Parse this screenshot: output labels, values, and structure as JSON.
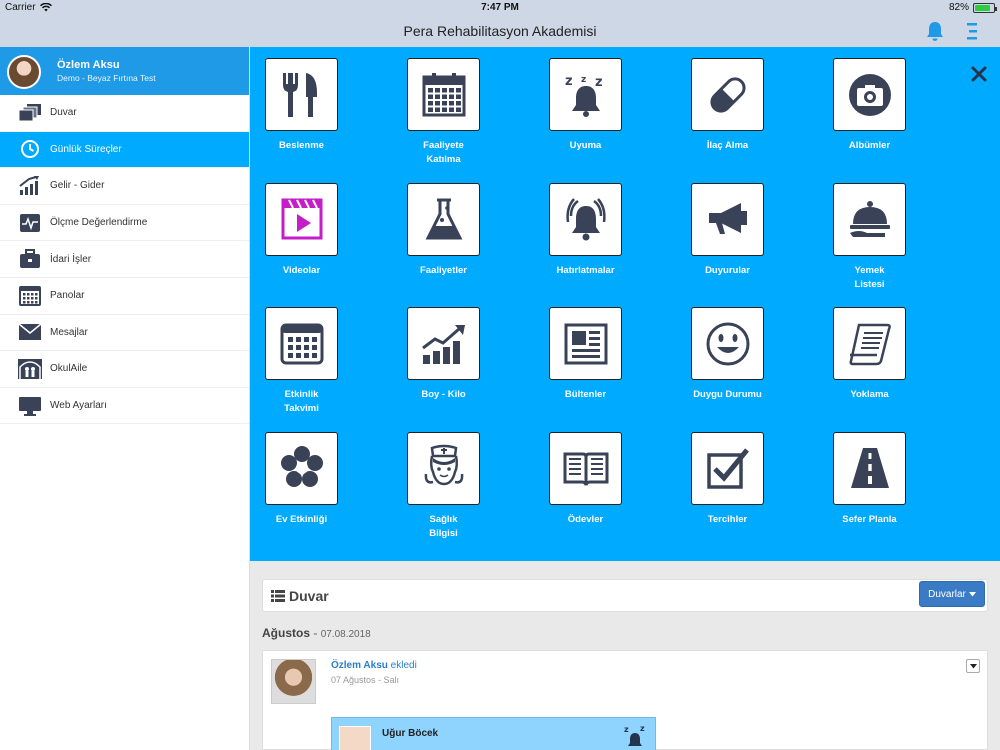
{
  "status_bar": {
    "carrier": "Carrier",
    "time": "7:47 PM",
    "battery": "82%",
    "battery_level": 0.82
  },
  "nav": {
    "title": "Pera Rehabilitasyon Akademisi"
  },
  "profile": {
    "name": "Özlem Aksu",
    "subtitle": "Demo - Beyaz Fırtına Test"
  },
  "sidebar": {
    "items": [
      {
        "label": "Duvar",
        "icon": "wall-icon"
      },
      {
        "label": "Günlük Süreçler",
        "icon": "clock-icon",
        "active": true
      },
      {
        "label": "Gelir - Gider",
        "icon": "growth-chart-icon"
      },
      {
        "label": "Ölçme Değerlendirme",
        "icon": "pulse-monitor-icon"
      },
      {
        "label": "İdari İşler",
        "icon": "briefcase-icon"
      },
      {
        "label": "Panolar",
        "icon": "calendar-board-icon"
      },
      {
        "label": "Mesajlar",
        "icon": "envelope-icon"
      },
      {
        "label": "OkulAile",
        "icon": "family-icon"
      },
      {
        "label": "Web Ayarları",
        "icon": "monitor-icon"
      }
    ]
  },
  "grid": {
    "tiles": [
      {
        "label": "Beslenme",
        "icon": "fork-knife-icon"
      },
      {
        "label": "Faaliyete Katılma",
        "icon": "calendar-grid-icon"
      },
      {
        "label": "Uyuma",
        "icon": "sleep-bell-icon"
      },
      {
        "label": "İlaç Alma",
        "icon": "pill-icon"
      },
      {
        "label": "Albümler",
        "icon": "camera-icon"
      },
      {
        "label": "Videolar",
        "icon": "video-clapper-icon"
      },
      {
        "label": "Faaliyetler",
        "icon": "flask-icon"
      },
      {
        "label": "Hatırlatmalar",
        "icon": "alarm-bell-icon"
      },
      {
        "label": "Duyurular",
        "icon": "megaphone-icon"
      },
      {
        "label": "Yemek Listesi",
        "icon": "food-cloche-icon"
      },
      {
        "label": "Etkinlik Takvimi",
        "icon": "event-calendar-icon"
      },
      {
        "label": "Boy - Kilo",
        "icon": "growth-bars-icon"
      },
      {
        "label": "Bültenler",
        "icon": "newsletter-icon"
      },
      {
        "label": "Duygu Durumu",
        "icon": "smiley-icon"
      },
      {
        "label": "Yoklama",
        "icon": "scroll-list-icon"
      },
      {
        "label": "Ev Etkinliği",
        "icon": "flower-icon"
      },
      {
        "label": "Sağlık Bilgisi",
        "icon": "nurse-icon"
      },
      {
        "label": "Ödevler",
        "icon": "open-book-icon"
      },
      {
        "label": "Tercihler",
        "icon": "checkbox-icon"
      },
      {
        "label": "Sefer Planla",
        "icon": "road-icon"
      }
    ]
  },
  "wall": {
    "title": "Duvar",
    "button": "Duvarlar",
    "month": "Ağustos",
    "date": "07.08.2018",
    "post": {
      "author": "Özlem Aksu",
      "action": "ekledi",
      "date": "07 Ağustos - Salı",
      "card_name": "Uğur Böcek"
    }
  },
  "colors": {
    "accent": "#00aaff",
    "profile_bg": "#1e9ae6",
    "navbar_bg": "#cdd7e5",
    "icon_dark": "#3a4257",
    "video_icon": "#c41ec9",
    "button_blue": "#3b7bc6"
  }
}
